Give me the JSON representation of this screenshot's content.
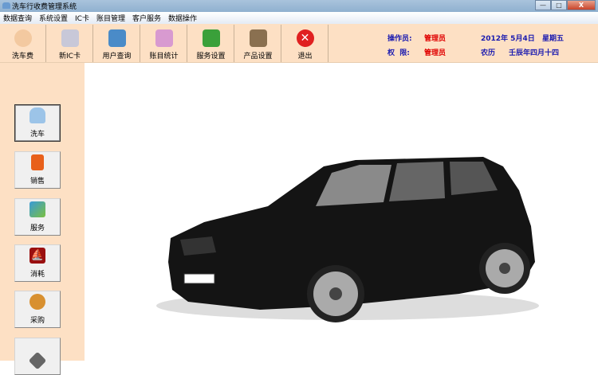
{
  "window": {
    "title": "洗车行收费管理系统",
    "minimize": "—",
    "maximize": "□",
    "close": "X"
  },
  "menu": [
    "数据查询",
    "系统设置",
    "IC卡",
    "账目管理",
    "客户服务",
    "数据操作"
  ],
  "toolbar": [
    {
      "label": "洗车费",
      "icon": "person-icon",
      "color": "#f3c9a0"
    },
    {
      "label": "新IC卡",
      "icon": "card-writing-icon",
      "color": "#c8c8d8"
    },
    {
      "label": "用户查询",
      "icon": "computer-globe-icon",
      "color": "#4a8bc8"
    },
    {
      "label": "账目统计",
      "icon": "people-chart-icon",
      "color": "#d89ad0"
    },
    {
      "label": "服务设置",
      "icon": "pencils-icon",
      "color": "#3aa03a"
    },
    {
      "label": "产品设置",
      "icon": "product-box-icon",
      "color": "#8a7050"
    },
    {
      "label": "退出",
      "icon": "exit-icon",
      "color": "#e02020"
    }
  ],
  "info": {
    "operator_label": "操作员:",
    "operator": "管理员",
    "permission_label": "权  限:",
    "permission": "管理员",
    "date": "2012年 5月4日",
    "weekday": "星期五",
    "lunar_label": "农历",
    "lunar_date": "壬辰年四月十四"
  },
  "sidebar": [
    {
      "label": "洗车",
      "icon": "car-icon",
      "color": "#9cc4e8",
      "active": true
    },
    {
      "label": "销售",
      "icon": "book-icon",
      "color": "#e8601a"
    },
    {
      "label": "服务",
      "icon": "globe-icon",
      "color": "#3a9ad8"
    },
    {
      "label": "消耗",
      "icon": "sailboat-icon",
      "color": "#9a1010"
    },
    {
      "label": "采购",
      "icon": "person-phone-icon",
      "color": "#d89030"
    },
    {
      "label": "",
      "icon": "hand-card-icon",
      "color": "#666"
    }
  ]
}
